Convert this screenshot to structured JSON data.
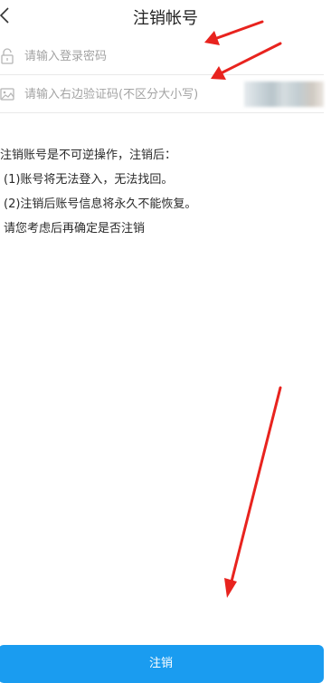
{
  "header": {
    "title": "注销帐号",
    "back_icon": "chevron-left-icon"
  },
  "form": {
    "password": {
      "placeholder": "请输入登录密码",
      "icon": "lock-icon",
      "value": ""
    },
    "captcha": {
      "placeholder": "请输入右边验证码(不区分大小写)",
      "icon": "image-icon",
      "value": ""
    }
  },
  "notice": {
    "lines": [
      "注销账号是不可逆操作，注销后：",
      "(1)账号将无法登入，无法找回。",
      "(2)注销后账号信息将永久不能恢复。",
      "请您考虑后再确定是否注销"
    ]
  },
  "actions": {
    "submit_label": "注销"
  },
  "colors": {
    "accent": "#1a9cf0",
    "annotation_arrow": "#e8231e",
    "placeholder": "#a3a3a3"
  }
}
